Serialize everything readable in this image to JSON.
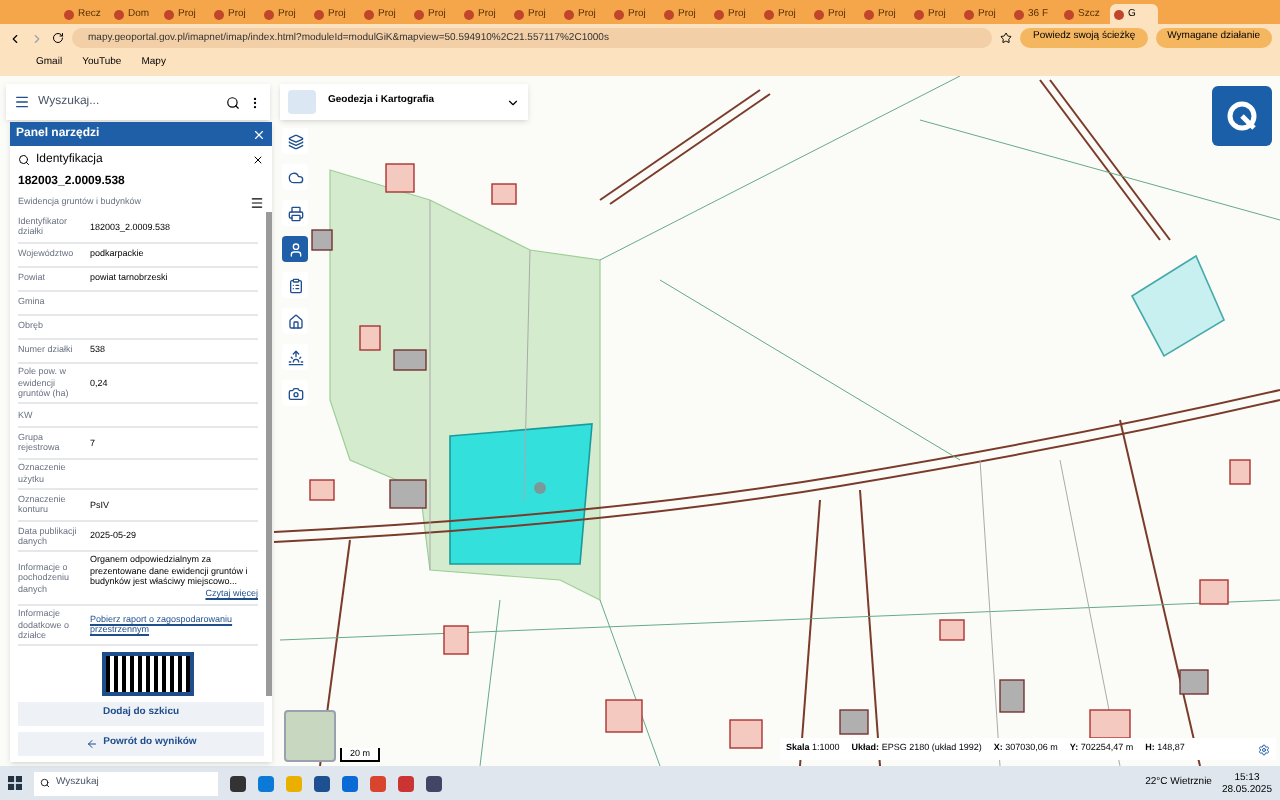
{
  "browser": {
    "tabs": [
      {
        "label": "Recz",
        "selected": false
      },
      {
        "label": "Dom",
        "selected": false
      },
      {
        "label": "Proj",
        "selected": false
      },
      {
        "label": "Proj",
        "selected": false
      },
      {
        "label": "Proj",
        "selected": false
      },
      {
        "label": "Proj",
        "selected": false
      },
      {
        "label": "Proj",
        "selected": false
      },
      {
        "label": "Proj",
        "selected": false
      },
      {
        "label": "Proj",
        "selected": false
      },
      {
        "label": "Proj",
        "selected": false
      },
      {
        "label": "Proj",
        "selected": false
      },
      {
        "label": "Proj",
        "selected": false
      },
      {
        "label": "Proj",
        "selected": false
      },
      {
        "label": "Proj",
        "selected": false
      },
      {
        "label": "Proj",
        "selected": false
      },
      {
        "label": "Proj",
        "selected": false
      },
      {
        "label": "Proj",
        "selected": false
      },
      {
        "label": "Proj",
        "selected": false
      },
      {
        "label": "Proj",
        "selected": false
      },
      {
        "label": "36 F",
        "selected": false
      },
      {
        "label": "Szcz",
        "selected": false
      },
      {
        "label": "G",
        "selected": true
      }
    ],
    "url": "mapy.geoportal.gov.pl/imapnet/imap/index.html?moduleId=modulGiK&mapview=50.594910%2C21.557117%2C1000s",
    "profile_button": "Powiedz swoją ścieżkę",
    "action_button": "Wymagane działanie",
    "bookmarks": [
      "Gmail",
      "YouTube",
      "Mapy"
    ]
  },
  "search": {
    "placeholder": "Wyszukaj..."
  },
  "layer_select": {
    "label": "Geodezja i Kartografia"
  },
  "tools": [
    {
      "kind": "layers",
      "selected": false
    },
    {
      "kind": "cloud",
      "selected": false
    },
    {
      "kind": "print",
      "selected": false
    },
    {
      "kind": "identify",
      "selected": true
    },
    {
      "kind": "clipboard",
      "selected": false
    },
    {
      "kind": "home",
      "selected": false
    },
    {
      "kind": "horizon",
      "selected": false
    },
    {
      "kind": "camera",
      "selected": false
    }
  ],
  "panel": {
    "title": "Panel narzędzi",
    "section": "Identyfikacja",
    "parcel_id": "182003_2.0009.538",
    "subtitle": "Ewidencja gruntów i budynków",
    "rows": [
      {
        "label": "Identyfikator działki",
        "value": "182003_2.0009.538"
      },
      {
        "label": "Województwo",
        "value": "podkarpackie"
      },
      {
        "label": "Powiat",
        "value": "powiat tarnobrzeski"
      },
      {
        "label": "Gmina"
      },
      {
        "label": "Obręb"
      },
      {
        "label": "Numer działki",
        "value": "538"
      },
      {
        "label": "Pole pow. w ewidencji gruntów (ha)",
        "value": "0,24"
      },
      {
        "label": "KW"
      },
      {
        "label": "Grupa rejestrowa",
        "value": "7"
      },
      {
        "label": "Oznaczenie użytku"
      },
      {
        "label": "Oznaczenie konturu",
        "value": "PsIV"
      },
      {
        "label": "Data publikacji danych",
        "value": "2025-05-29"
      },
      {
        "label": "Informacje o pochodzeniu danych",
        "value": "Organem odpowiedzialnym za prezentowane dane ewidencji gruntów i budynków jest właściwy miejscowo...",
        "more": "Czytaj więcej"
      },
      {
        "label": "Informacje dodatkowe o działce",
        "link": "Pobierz raport o zagospodarowaniu przestrzennym"
      }
    ],
    "add_button": "Dodaj do szkicu",
    "back_button": "Powrót do wyników"
  },
  "scale_bar": "20 m",
  "status_bar": [
    {
      "label": "Skala",
      "value": "1:1000"
    },
    {
      "label": "Układ:",
      "value": "EPSG 2180 (układ 1992)"
    },
    {
      "label": "X:",
      "value": "307030,06 m"
    },
    {
      "label": "Y:",
      "value": "702254,47 m"
    },
    {
      "label": "H:",
      "value": "148,87"
    }
  ],
  "taskbar": {
    "search": "Wyszukaj",
    "weather": "22°C  Wietrznie",
    "time": "15:13",
    "date": "28.05.2025"
  }
}
